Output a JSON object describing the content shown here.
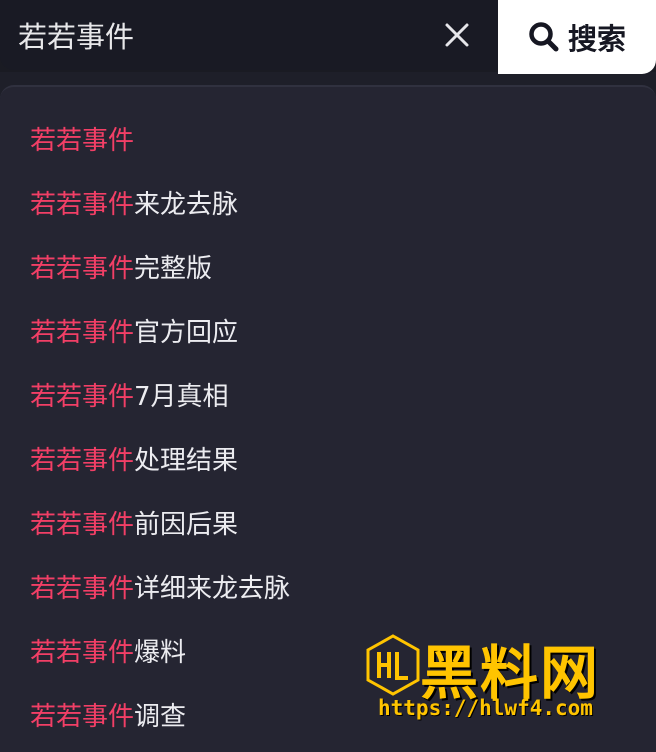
{
  "search": {
    "query": "若若事件",
    "clear_icon": "close-icon",
    "button_icon": "search-icon",
    "button_label": "搜索"
  },
  "suggestions": [
    {
      "highlight": "若若事件",
      "rest": ""
    },
    {
      "highlight": "若若事件",
      "rest": "来龙去脉"
    },
    {
      "highlight": "若若事件",
      "rest": "完整版"
    },
    {
      "highlight": "若若事件",
      "rest": "官方回应"
    },
    {
      "highlight": "若若事件",
      "rest": "7月真相"
    },
    {
      "highlight": "若若事件",
      "rest": "处理结果"
    },
    {
      "highlight": "若若事件",
      "rest": "前因后果"
    },
    {
      "highlight": "若若事件",
      "rest": "详细来龙去脉"
    },
    {
      "highlight": "若若事件",
      "rest": "爆料"
    },
    {
      "highlight": "若若事件",
      "rest": "调查"
    }
  ],
  "watermark": {
    "title": "黑料网",
    "url": "https://hlwf4.com"
  },
  "colors": {
    "highlight": "#f23f66",
    "background": "#252532",
    "watermark": "#ffc400"
  }
}
